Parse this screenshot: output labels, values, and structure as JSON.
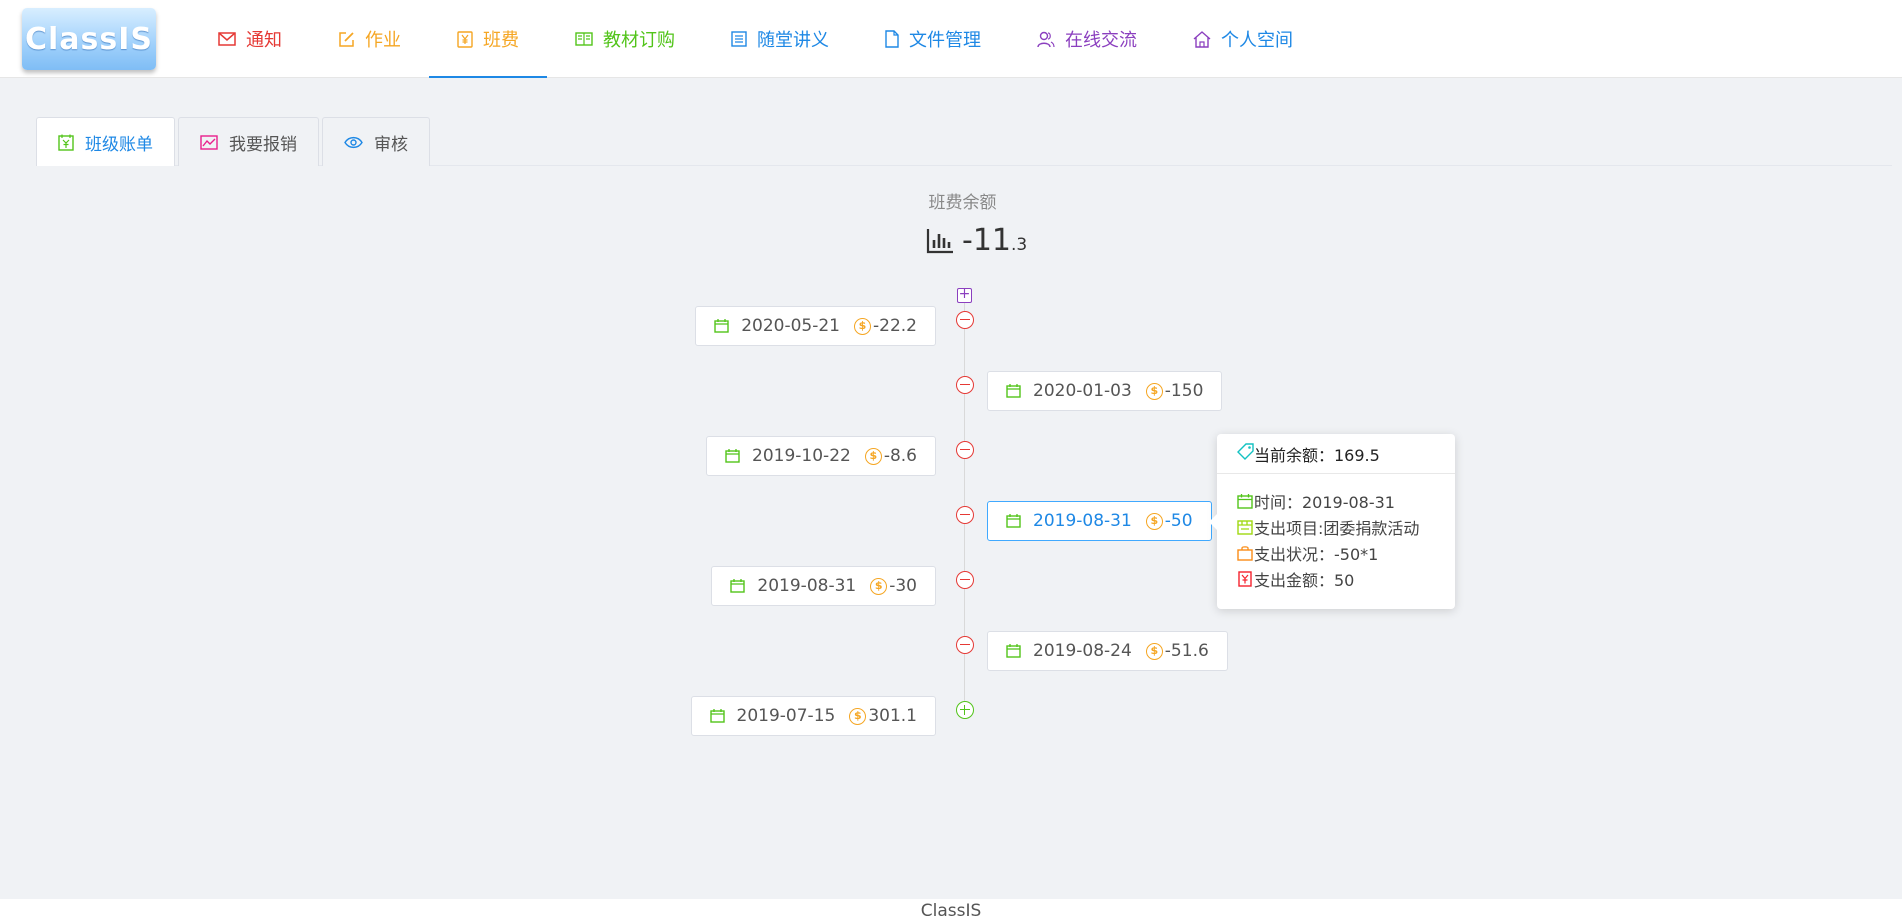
{
  "app": {
    "logo_text": "ClassIS"
  },
  "nav": [
    {
      "label": "通知",
      "icon": "mail-icon",
      "color": "#e53935"
    },
    {
      "label": "作业",
      "icon": "edit-icon",
      "color": "#f5a623"
    },
    {
      "label": "班费",
      "icon": "yen-icon",
      "color": "#f5a623",
      "active": true
    },
    {
      "label": "教材订购",
      "icon": "book-icon",
      "color": "#52c41a"
    },
    {
      "label": "随堂讲义",
      "icon": "list-icon",
      "color": "#1e88e5"
    },
    {
      "label": "文件管理",
      "icon": "file-icon",
      "color": "#1e88e5"
    },
    {
      "label": "在线交流",
      "icon": "users-icon",
      "color": "#8b3fbf"
    },
    {
      "label": "个人空间",
      "icon": "home-icon",
      "color": "#1e88e5"
    }
  ],
  "tabs": [
    {
      "label": "班级账单",
      "icon": "ledger-icon",
      "active": true
    },
    {
      "label": "我要报销",
      "icon": "chart-icon"
    },
    {
      "label": "审核",
      "icon": "eye-icon"
    }
  ],
  "balance": {
    "label": "班费余额",
    "integer": "-11",
    "decimal": ".3"
  },
  "timeline": [
    {
      "date": "2020-05-21",
      "amount": "-22.2",
      "side": "left",
      "type": "expense"
    },
    {
      "date": "2020-01-03",
      "amount": "-150",
      "side": "right",
      "type": "expense"
    },
    {
      "date": "2019-10-22",
      "amount": "-8.6",
      "side": "left",
      "type": "expense"
    },
    {
      "date": "2019-08-31",
      "amount": "-50",
      "side": "right",
      "type": "expense",
      "highlighted": true
    },
    {
      "date": "2019-08-31",
      "amount": "-30",
      "side": "left",
      "type": "expense"
    },
    {
      "date": "2019-08-24",
      "amount": "-51.6",
      "side": "right",
      "type": "expense"
    },
    {
      "date": "2019-07-15",
      "amount": "301.1",
      "side": "left",
      "type": "income"
    }
  ],
  "tooltip": {
    "header": "当前余额：169.5",
    "rows": [
      {
        "text": "时间：2019-08-31",
        "icon": "calendar-icon"
      },
      {
        "text": "支出项目:团委捐款活动",
        "icon": "store-icon"
      },
      {
        "text": "支出状况：-50*1",
        "icon": "bag-icon"
      },
      {
        "text": "支出金额：50",
        "icon": "receipt-icon"
      }
    ]
  },
  "footer": {
    "text": "ClassIS"
  }
}
